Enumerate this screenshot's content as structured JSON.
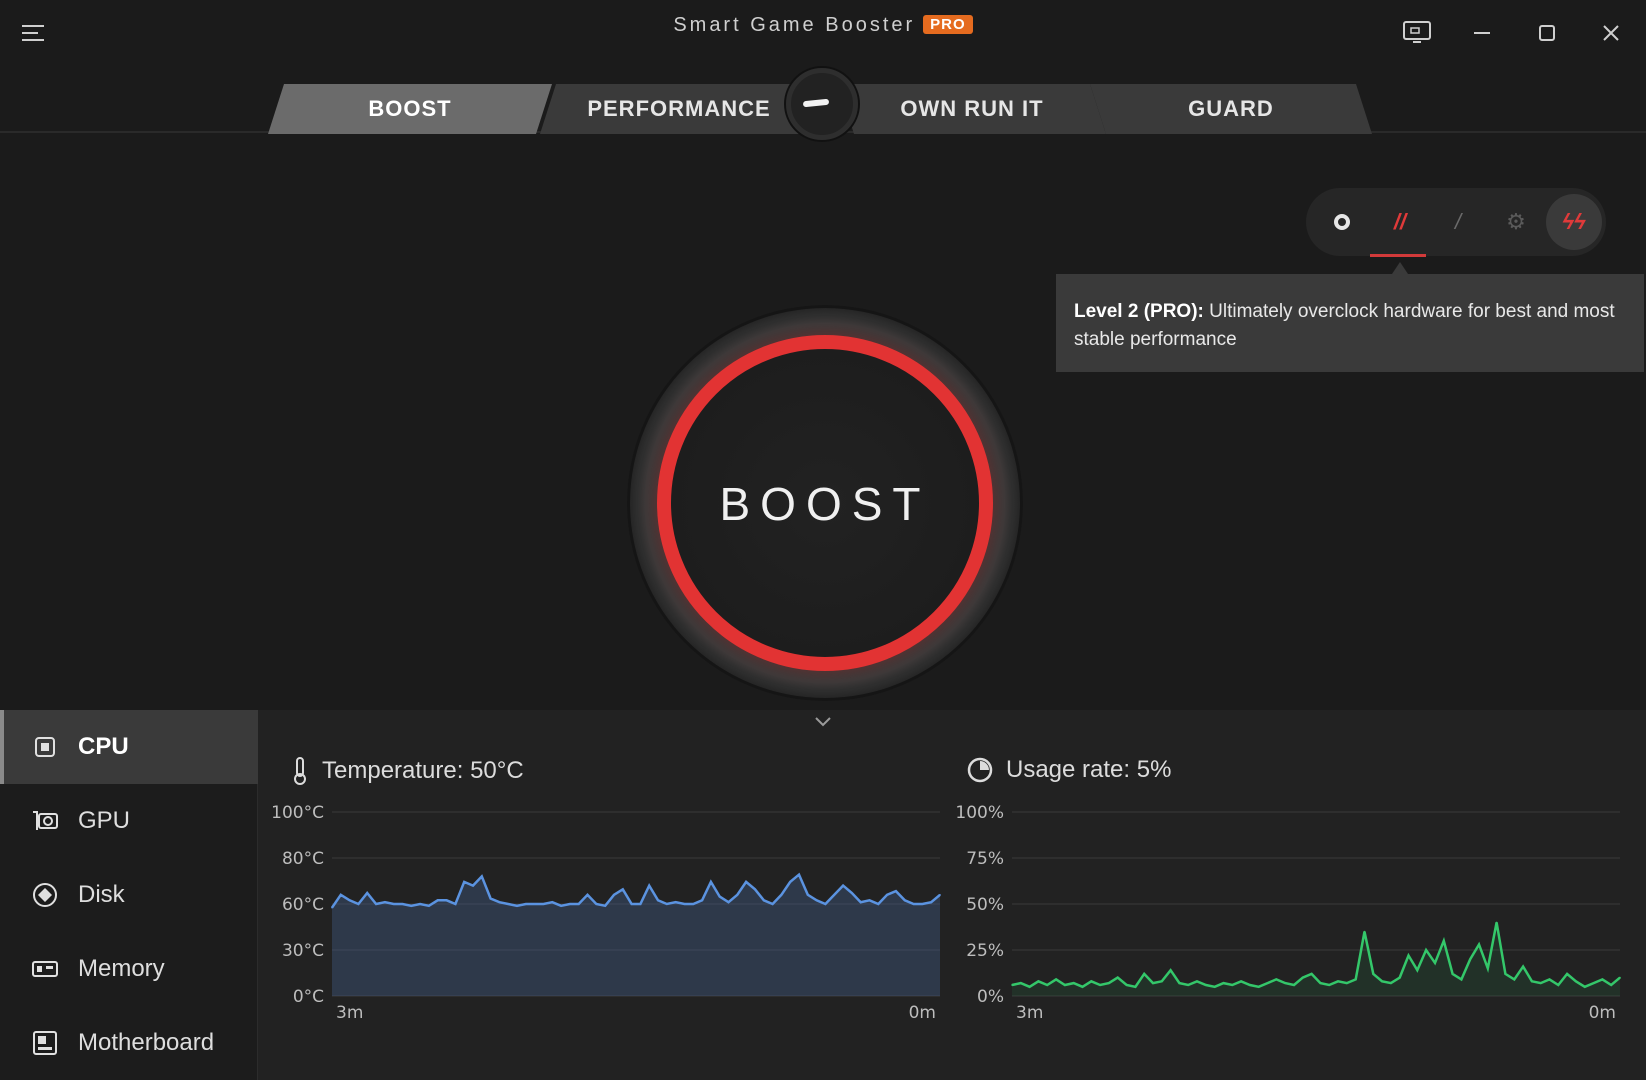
{
  "app": {
    "title": "Smart Game Booster",
    "pro_badge": "PRO"
  },
  "tabs": [
    {
      "label": "BOOST",
      "active": true
    },
    {
      "label": "PERFORMANCE",
      "active": false
    },
    {
      "label": "OWN RUN IT",
      "active": false
    },
    {
      "label": "GUARD",
      "active": false
    }
  ],
  "boost_levels": {
    "selected_level": 2,
    "options": [
      "level-0",
      "level-1",
      "level-2",
      "level-3",
      "level-4"
    ],
    "tooltip_heading": "Level 2 (PRO):",
    "tooltip_text": " Ultimately overclock hardware for best and most stable performance"
  },
  "boost_button": {
    "label": "BOOST"
  },
  "sidebar": {
    "items": [
      {
        "label": "CPU",
        "icon": "cpu-icon",
        "active": true
      },
      {
        "label": "GPU",
        "icon": "gpu-icon",
        "active": false
      },
      {
        "label": "Disk",
        "icon": "disk-icon",
        "active": false
      },
      {
        "label": "Memory",
        "icon": "memory-icon",
        "active": false
      },
      {
        "label": "Motherboard",
        "icon": "motherboard-icon",
        "active": false
      }
    ]
  },
  "metrics": {
    "temperature_label": "Temperature: 50°C",
    "usage_label": "Usage rate: 5%"
  },
  "colors": {
    "accent_red": "#e23333",
    "temp_line": "#5b93e0",
    "usage_line": "#34c76a",
    "pro_badge": "#e56b1f"
  },
  "chart_data": [
    {
      "type": "area",
      "title": "Temperature: 50°C",
      "y_tick_labels": [
        "100°C",
        "80°C",
        "60°C",
        "30°C",
        "0°C"
      ],
      "ylim": [
        0,
        100
      ],
      "x_tick_labels": [
        "3m",
        "0m"
      ],
      "series": [
        {
          "values": [
            48,
            55,
            52,
            50,
            56,
            50,
            51,
            50,
            50,
            49,
            50,
            49,
            52,
            52,
            50,
            62,
            60,
            65,
            53,
            51,
            50,
            49,
            50,
            50,
            50,
            51,
            49,
            50,
            50,
            55,
            50,
            49,
            55,
            58,
            50,
            50,
            60,
            52,
            50,
            51,
            50,
            50,
            52,
            62,
            54,
            51,
            55,
            62,
            58,
            52,
            50,
            55,
            62,
            66,
            55,
            52,
            50,
            55,
            60,
            56,
            51,
            52,
            50,
            55,
            57,
            52,
            50,
            50,
            51,
            55
          ]
        }
      ]
    },
    {
      "type": "area",
      "title": "Usage rate: 5%",
      "y_tick_labels": [
        "100%",
        "75%",
        "50%",
        "25%",
        "0%"
      ],
      "ylim": [
        0,
        100
      ],
      "x_tick_labels": [
        "3m",
        "0m"
      ],
      "series": [
        {
          "values": [
            6,
            7,
            5,
            8,
            6,
            9,
            6,
            7,
            5,
            8,
            6,
            7,
            10,
            6,
            5,
            12,
            7,
            8,
            14,
            7,
            6,
            8,
            6,
            5,
            7,
            6,
            8,
            6,
            5,
            7,
            9,
            7,
            6,
            10,
            12,
            7,
            6,
            8,
            7,
            9,
            35,
            12,
            8,
            7,
            10,
            22,
            14,
            25,
            18,
            30,
            12,
            9,
            20,
            28,
            15,
            40,
            12,
            9,
            16,
            8,
            7,
            9,
            6,
            12,
            8,
            5,
            7,
            9,
            6,
            10
          ]
        }
      ]
    }
  ]
}
